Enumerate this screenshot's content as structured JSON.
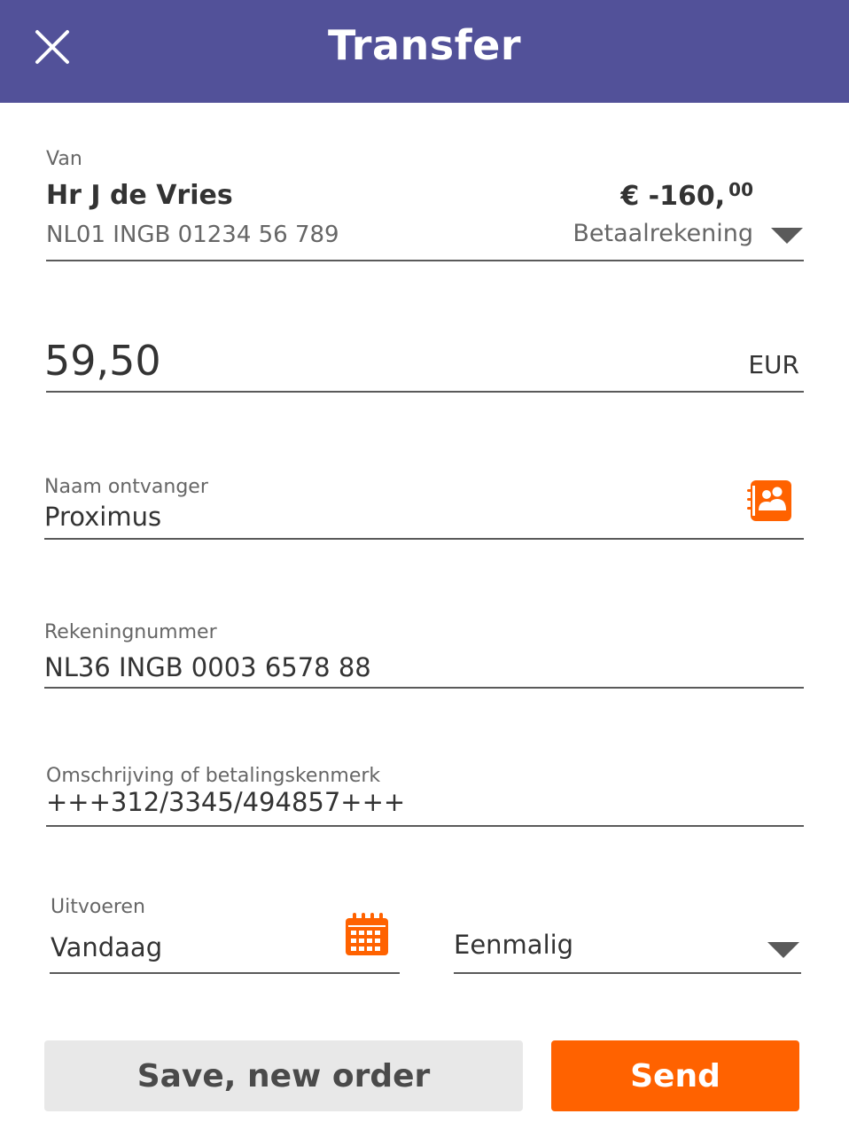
{
  "header": {
    "title": "Transfer",
    "close_icon": "close-icon"
  },
  "from": {
    "label": "Van",
    "name": "Hr J de Vries",
    "iban": "NL01 INGB 01234 56 789",
    "balance_main": "€ -160,",
    "balance_cents": "00",
    "account_type": "Betaalrekening"
  },
  "amount": {
    "value": "59,50",
    "currency": "EUR"
  },
  "recipient": {
    "label": "Naam ontvanger",
    "value": "Proximus",
    "icon": "contact-book-icon"
  },
  "account_number": {
    "label": "Rekeningnummer",
    "value": "NL36 INGB 0003 6578 88"
  },
  "description": {
    "label": "Omschrijving of betalingskenmerk",
    "value": "+++312/3345/494857+++"
  },
  "execute": {
    "label": "Uitvoeren",
    "date_value": "Vandaag",
    "frequency": "Eenmalig",
    "calendar_icon": "calendar-icon"
  },
  "buttons": {
    "save_label": "Save, new order",
    "send_label": "Send"
  },
  "colors": {
    "header_bg": "#525199",
    "accent": "#ff6200",
    "secondary_button_bg": "#e8e8e8"
  }
}
